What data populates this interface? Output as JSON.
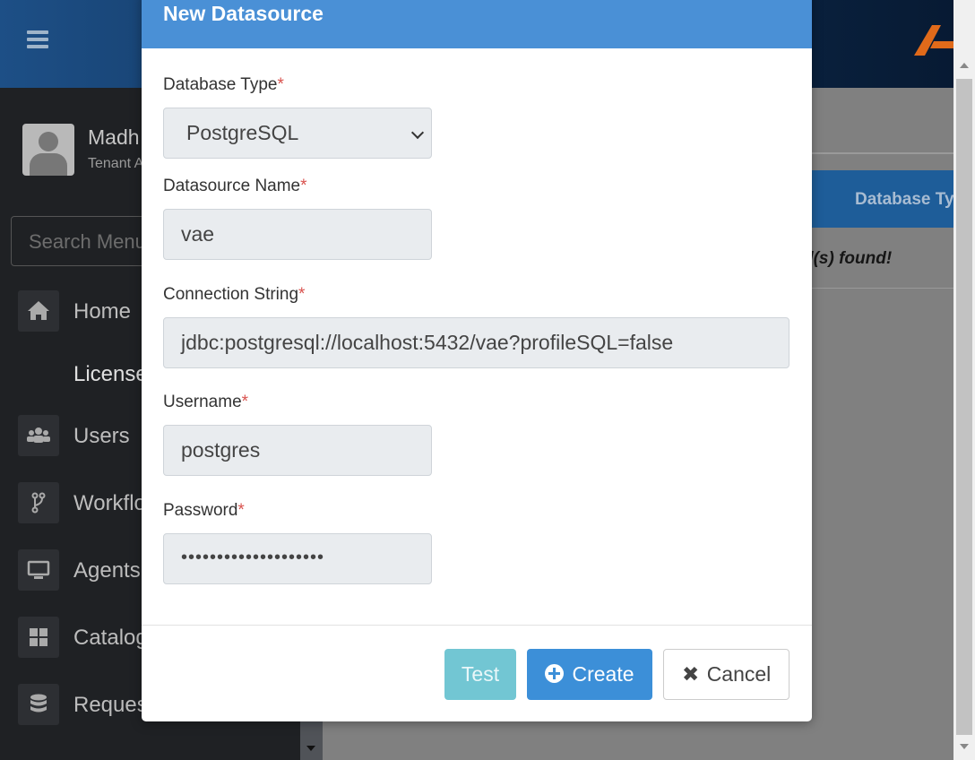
{
  "app": {
    "user_name": "Madh",
    "user_role": "Tenant A",
    "search_placeholder": "Search Menu",
    "menu": [
      {
        "label": "Home",
        "icon": "home-icon"
      },
      {
        "label": "License",
        "icon": ""
      },
      {
        "label": "Users",
        "icon": "users-icon"
      },
      {
        "label": "Workflo",
        "icon": "workflow-icon"
      },
      {
        "label": "Agents",
        "icon": "desktop-icon"
      },
      {
        "label": "Catalog",
        "icon": "grid-icon"
      },
      {
        "label": "Request",
        "icon": "database-icon"
      }
    ],
    "table_header": "Database Ty",
    "no_records": "d(s) found!"
  },
  "modal": {
    "title": "New Datasource",
    "database_type": {
      "label": "Database Type",
      "required": "*",
      "value": "PostgreSQL"
    },
    "datasource_name": {
      "label": "Datasource Name",
      "required": "*",
      "value": "vae"
    },
    "connection_string": {
      "label": "Connection String",
      "required": "*",
      "value": "jdbc:postgresql://localhost:5432/vae?profileSQL=false"
    },
    "username": {
      "label": "Username",
      "required": "*",
      "value": "postgres"
    },
    "password": {
      "label": "Password",
      "required": "*",
      "value": "••••••••••••••••••••"
    },
    "buttons": {
      "test": "Test",
      "create": "Create",
      "cancel": "Cancel"
    }
  },
  "colors": {
    "modal_header": "#4a90d6",
    "create_button": "#3c8fd8",
    "test_button": "#72c6d3",
    "required_star": "#d9534f"
  }
}
